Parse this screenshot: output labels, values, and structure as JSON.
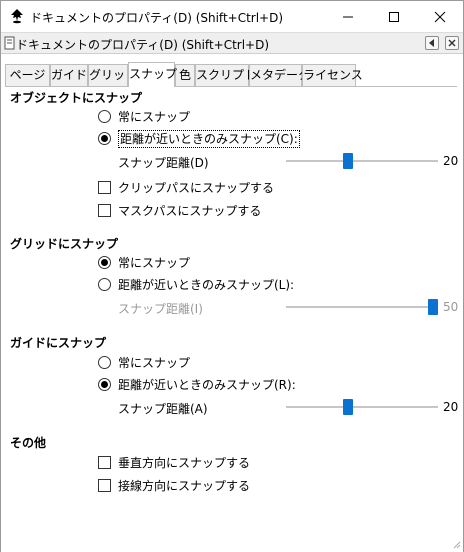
{
  "window": {
    "title": "ドキュメントのプロパティ(D) (Shift+Ctrl+D)",
    "app_icon": "inkscape-icon",
    "controls": [
      "minimize-icon",
      "maximize-icon",
      "close-icon"
    ]
  },
  "dock": {
    "title": "ドキュメントのプロパティ(D) (Shift+Ctrl+D)",
    "buttons": [
      "dock-back-icon",
      "dock-close-icon"
    ]
  },
  "tabs": [
    {
      "label": "ページ",
      "active": false
    },
    {
      "label": "ガイド",
      "active": false
    },
    {
      "label": "グリッド",
      "active": false
    },
    {
      "label": "スナップ",
      "active": true
    },
    {
      "label": "色",
      "active": false
    },
    {
      "label": "スクリプト",
      "active": false
    },
    {
      "label": "メタデータ",
      "active": false
    },
    {
      "label": "ライセンス",
      "active": false
    }
  ],
  "object_snap": {
    "title": "オブジェクトにスナップ",
    "always_label": "常にスナップ",
    "always_selected": false,
    "near_label": "距離が近いときのみスナップ(C):",
    "near_selected": true,
    "distance_label": "スナップ距離(D)",
    "distance_value": "20",
    "distance_fraction": 0.4,
    "clip_label": "クリップパスにスナップする",
    "clip_checked": false,
    "mask_label": "マスクパスにスナップする",
    "mask_checked": false
  },
  "grid_snap": {
    "title": "グリッドにスナップ",
    "always_label": "常にスナップ",
    "always_selected": true,
    "near_label": "距離が近いときのみスナップ(L):",
    "near_selected": false,
    "distance_label": "スナップ距離(I)",
    "distance_value": "50",
    "distance_fraction": 1.0,
    "distance_disabled": true
  },
  "guide_snap": {
    "title": "ガイドにスナップ",
    "always_label": "常にスナップ",
    "always_selected": false,
    "near_label": "距離が近いときのみスナップ(R):",
    "near_selected": true,
    "distance_label": "スナップ距離(A)",
    "distance_value": "20",
    "distance_fraction": 0.4
  },
  "other": {
    "title": "その他",
    "perpendicular_label": "垂直方向にスナップする",
    "perpendicular_checked": false,
    "tangential_label": "接線方向にスナップする",
    "tangential_checked": false
  },
  "colors": {
    "accent": "#0a72d0",
    "track": "#c6c6c6",
    "disabled_text": "#9a9a9a"
  }
}
